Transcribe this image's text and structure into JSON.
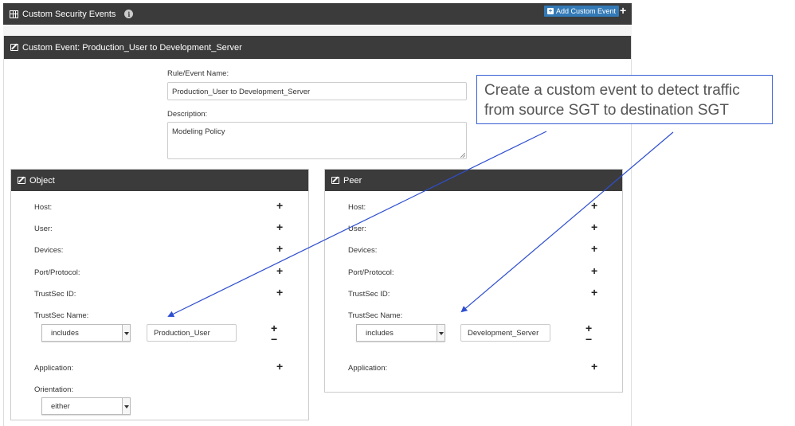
{
  "topbar": {
    "title": "Custom Security Events",
    "add_button": "Add Custom Event"
  },
  "panel": {
    "title": "Custom Event: Production_User to Development_Server"
  },
  "form": {
    "name_label": "Rule/Event Name:",
    "name_value": "Production_User to Development_Server",
    "description_label": "Description:",
    "description_value": "Modeling Policy"
  },
  "object": {
    "title": "Object",
    "host": "Host:",
    "user": "User:",
    "devices": "Devices:",
    "port_protocol": "Port/Protocol:",
    "trustsec_id": "TrustSec ID:",
    "trustsec_name": "TrustSec Name:",
    "trustsec_operator": "includes",
    "trustsec_value": "Production_User",
    "application": "Application:",
    "orientation": "Orientation:",
    "orientation_value": "either"
  },
  "peer": {
    "title": "Peer",
    "host": "Host:",
    "user": "User:",
    "devices": "Devices:",
    "port_protocol": "Port/Protocol:",
    "trustsec_id": "TrustSec ID:",
    "trustsec_name": "TrustSec Name:",
    "trustsec_operator": "includes",
    "trustsec_value": "Development_Server",
    "application": "Application:"
  },
  "callout": {
    "text": "Create a custom event to detect traffic from source SGT to destination SGT"
  },
  "colors": {
    "header_bg": "#3b3b3b",
    "button_blue": "#337ab7",
    "callout_border": "#3a5fd6",
    "arrow": "#2f4fd0"
  }
}
